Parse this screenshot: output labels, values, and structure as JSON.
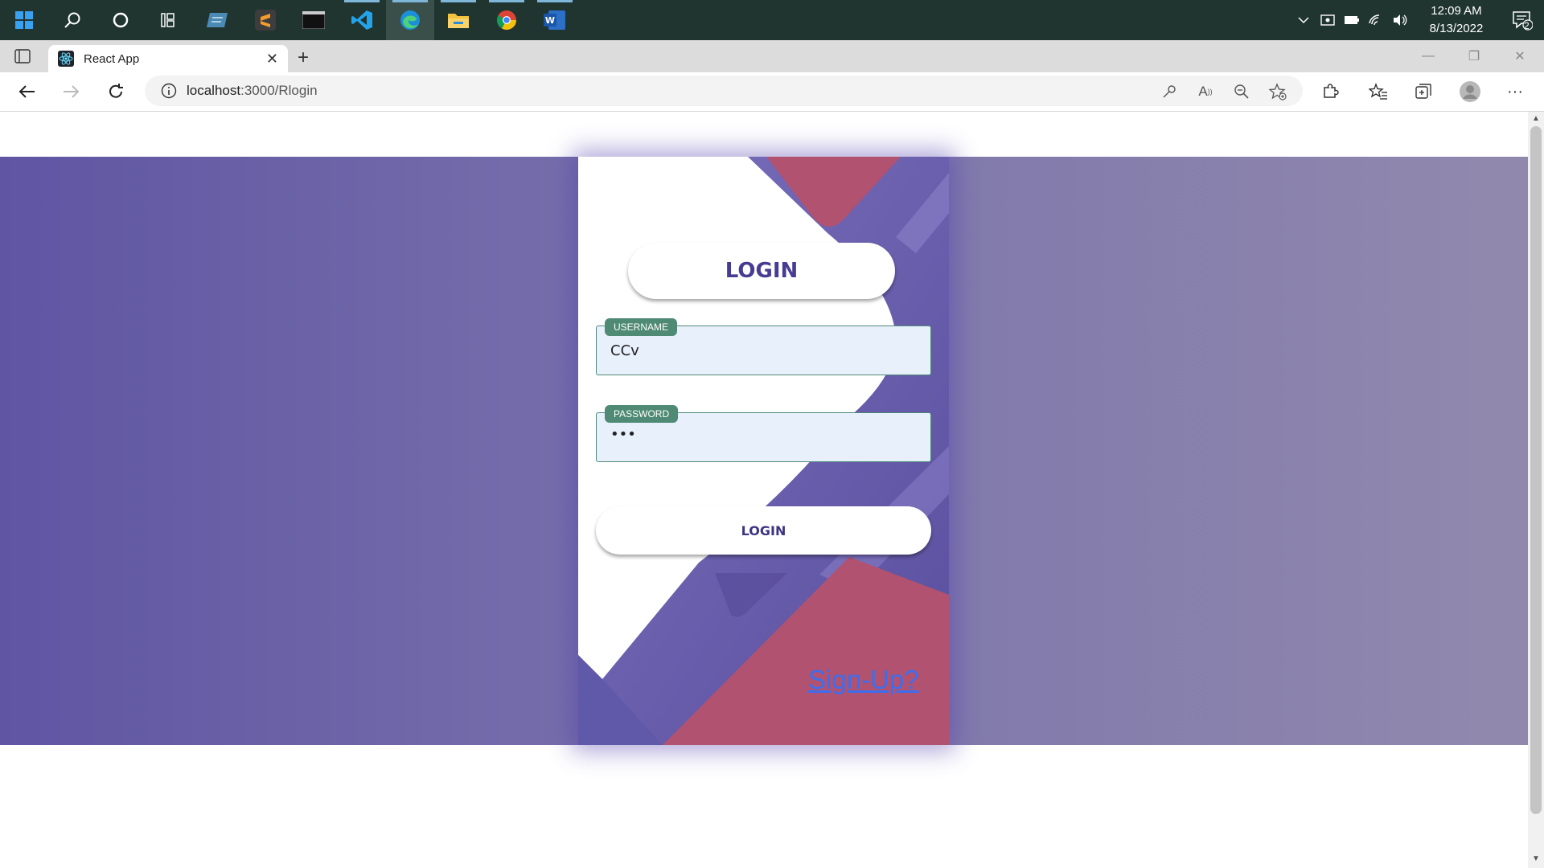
{
  "taskbar": {
    "apps": [
      {
        "name": "start-icon"
      },
      {
        "name": "search-icon"
      },
      {
        "name": "cortana-icon"
      },
      {
        "name": "task-view-icon"
      },
      {
        "name": "app-icon"
      },
      {
        "name": "sublime-text-icon"
      },
      {
        "name": "terminal-icon"
      },
      {
        "name": "vscode-icon"
      },
      {
        "name": "edge-icon"
      },
      {
        "name": "file-explorer-icon"
      },
      {
        "name": "chrome-icon"
      },
      {
        "name": "word-icon"
      }
    ],
    "clock": {
      "time": "12:09 AM",
      "date": "8/13/2022"
    },
    "notification_count": "2"
  },
  "browser": {
    "tab_title": "React App",
    "url_host": "localhost",
    "url_path": ":3000/Rlogin"
  },
  "login": {
    "title": "LOGIN",
    "username_label": "USERNAME",
    "username_value": "CCv",
    "password_label": "PASSWORD",
    "password_value": "•••",
    "button_label": "LOGIN",
    "signup_link": "Sign-Up?"
  },
  "colors": {
    "accent_purple": "#5f55a3",
    "rose": "#b4526a",
    "field_tag": "#4e8a74"
  }
}
